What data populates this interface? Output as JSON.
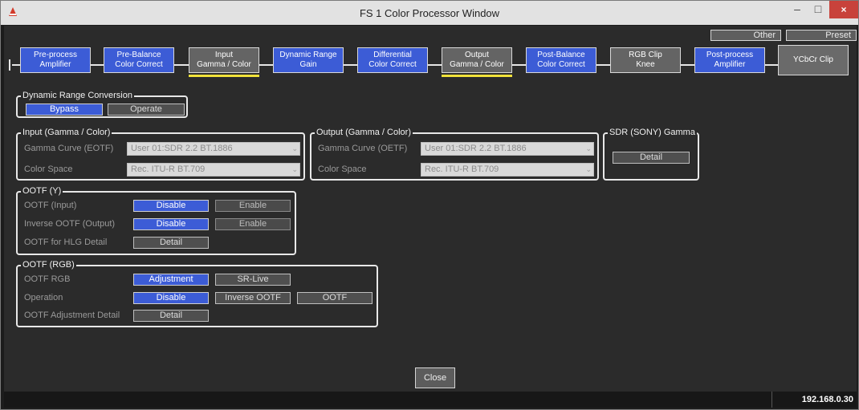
{
  "window": {
    "title": "FS 1 Color Processor Window",
    "minimize": "–",
    "maximize": "□",
    "close": "×"
  },
  "top_buttons": {
    "other": "Other",
    "preset": "Preset"
  },
  "stages": [
    {
      "l1": "Pre-process",
      "l2": "Amplifier"
    },
    {
      "l1": "Pre-Balance",
      "l2": "Color Correct"
    },
    {
      "l1": "Input",
      "l2": "Gamma / Color"
    },
    {
      "l1": "Dynamic Range",
      "l2": "Gain"
    },
    {
      "l1": "Differential",
      "l2": "Color Correct"
    },
    {
      "l1": "Output",
      "l2": "Gamma / Color"
    },
    {
      "l1": "Post-Balance",
      "l2": "Color Correct"
    },
    {
      "l1": "RGB Clip",
      "l2": "Knee"
    },
    {
      "l1": "Post-process",
      "l2": "Amplifier"
    },
    {
      "l1": "YCbCr Clip",
      "l2": ""
    }
  ],
  "drc": {
    "title": "Dynamic Range Conversion",
    "bypass": "Bypass",
    "operate": "Operate"
  },
  "input": {
    "title": "Input (Gamma / Color)",
    "curve_label": "Gamma Curve (EOTF)",
    "curve_value": "User 01:SDR 2.2 BT.1886",
    "space_label": "Color Space",
    "space_value": "Rec. ITU-R BT.709"
  },
  "output": {
    "title": "Output (Gamma / Color)",
    "curve_label": "Gamma Curve (OETF)",
    "curve_value": "User 01:SDR 2.2 BT.1886",
    "space_label": "Color Space",
    "space_value": "Rec. ITU-R BT.709"
  },
  "sdr": {
    "title": "SDR (SONY) Gamma",
    "detail": "Detail"
  },
  "ootf_y": {
    "title": "OOTF (Y)",
    "input_label": "OOTF (Input)",
    "inverse_label": "Inverse OOTF (Output)",
    "hlg_label": "OOTF for HLG Detail",
    "disable": "Disable",
    "enable": "Enable",
    "detail": "Detail"
  },
  "ootf_rgb": {
    "title": "OOTF (RGB)",
    "rgb_label": "OOTF RGB",
    "operation_label": "Operation",
    "adj_detail_label": "OOTF Adjustment Detail",
    "adjustment": "Adjustment",
    "srlive": "SR-Live",
    "disable": "Disable",
    "inverse": "Inverse OOTF",
    "ootf": "OOTF",
    "detail": "Detail"
  },
  "close_label": "Close",
  "status": {
    "ip": "192.168.0.30"
  }
}
